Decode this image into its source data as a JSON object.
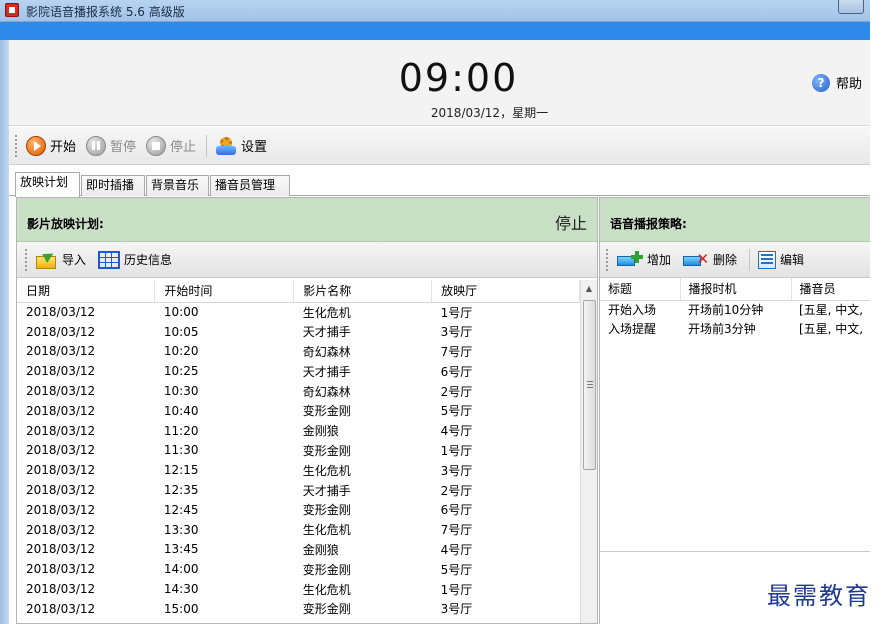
{
  "window": {
    "title": "影院语音播报系统 5.6 高级版"
  },
  "header": {
    "time": "09:00",
    "date": "2018/03/12，星期一",
    "help_label": "帮助"
  },
  "toolbar": {
    "start_label": "开始",
    "pause_label": "暂停",
    "stop_label": "停止",
    "settings_label": "设置"
  },
  "tabs": [
    {
      "label": "放映计划",
      "active": true
    },
    {
      "label": "即时插播",
      "active": false
    },
    {
      "label": "背景音乐",
      "active": false
    },
    {
      "label": "播音员管理",
      "active": false
    }
  ],
  "schedule": {
    "title": "影片放映计划:",
    "status": "停止",
    "import_label": "导入",
    "history_label": "历史信息",
    "columns": [
      "日期",
      "开始时间",
      "影片名称",
      "放映厅"
    ],
    "rows": [
      [
        "2018/03/12",
        "10:00",
        "生化危机",
        "1号厅"
      ],
      [
        "2018/03/12",
        "10:05",
        "天才捕手",
        "3号厅"
      ],
      [
        "2018/03/12",
        "10:20",
        "奇幻森林",
        "7号厅"
      ],
      [
        "2018/03/12",
        "10:25",
        "天才捕手",
        "6号厅"
      ],
      [
        "2018/03/12",
        "10:30",
        "奇幻森林",
        "2号厅"
      ],
      [
        "2018/03/12",
        "10:40",
        "变形金刚",
        "5号厅"
      ],
      [
        "2018/03/12",
        "11:20",
        "金刚狼",
        "4号厅"
      ],
      [
        "2018/03/12",
        "11:30",
        "变形金刚",
        "1号厅"
      ],
      [
        "2018/03/12",
        "12:15",
        "生化危机",
        "3号厅"
      ],
      [
        "2018/03/12",
        "12:35",
        "天才捕手",
        "2号厅"
      ],
      [
        "2018/03/12",
        "12:45",
        "变形金刚",
        "6号厅"
      ],
      [
        "2018/03/12",
        "13:30",
        "生化危机",
        "7号厅"
      ],
      [
        "2018/03/12",
        "13:45",
        "金刚狼",
        "4号厅"
      ],
      [
        "2018/03/12",
        "14:00",
        "变形金刚",
        "5号厅"
      ],
      [
        "2018/03/12",
        "14:30",
        "生化危机",
        "1号厅"
      ],
      [
        "2018/03/12",
        "15:00",
        "变形金刚",
        "3号厅"
      ]
    ]
  },
  "strategy": {
    "title": "语音播报策略:",
    "add_label": "增加",
    "delete_label": "删除",
    "edit_label": "编辑",
    "columns": [
      "标题",
      "播报时机",
      "播音员"
    ],
    "rows": [
      [
        "开始入场",
        "开场前10分钟",
        "[五星, 中文,"
      ],
      [
        "入场提醒",
        "开场前3分钟",
        "[五星, 中文,"
      ]
    ]
  },
  "watermark": "最需教育"
}
